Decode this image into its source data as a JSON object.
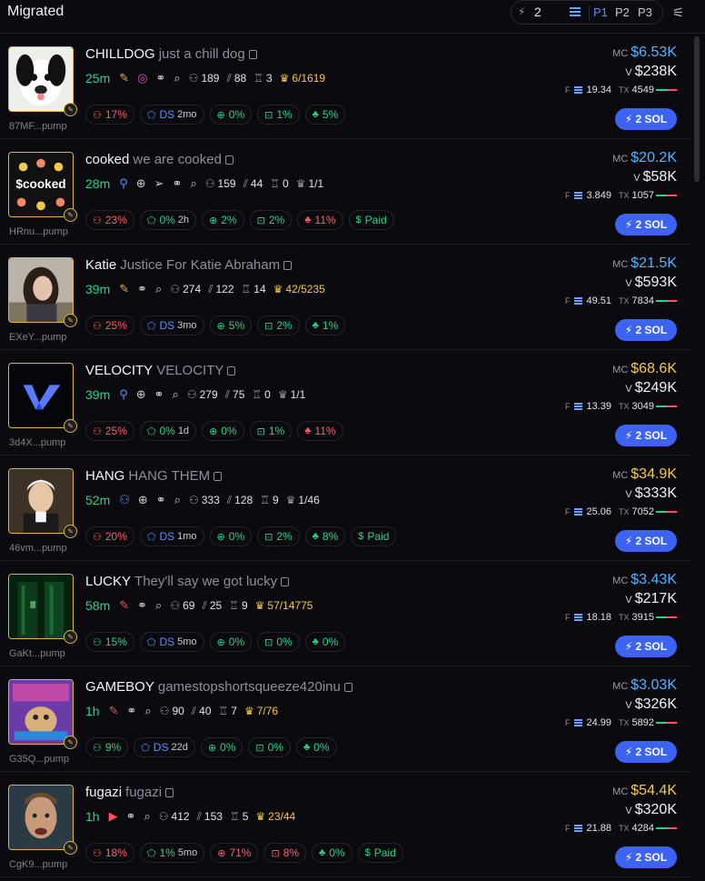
{
  "header": {
    "title": "Migrated",
    "speed": "2",
    "presets": [
      "P1",
      "P2",
      "P3"
    ]
  },
  "rows": [
    {
      "ticker": "CHILLDOG",
      "name": "just a chill dog",
      "age": "25m",
      "addr": "87MF...pump",
      "icons": [
        "feather-icon",
        "instagram-icon",
        "link-icon",
        "search-icon"
      ],
      "holders": "189",
      "pro": "88",
      "trophy": "3",
      "crown": "6/1619",
      "crown_gold": true,
      "pills": [
        {
          "name": "top10-pill",
          "glyph": "⚇",
          "text": "17%",
          "color": "red"
        },
        {
          "name": "dev-pill",
          "glyph": "⬠",
          "text": "DS",
          "sub": "2mo",
          "color": "blue"
        },
        {
          "name": "sniper-pill",
          "glyph": "⊕",
          "text": "0%",
          "color": "green"
        },
        {
          "name": "insider-pill",
          "glyph": "⊡",
          "text": "1%",
          "color": "green"
        },
        {
          "name": "bundle-pill",
          "glyph": "♣",
          "text": "5%",
          "color": "green"
        }
      ],
      "mc": "$6.53K",
      "mc_color": "blue",
      "vol": "$238K",
      "fees": "19.34",
      "tx": "4549",
      "buy_ratio": 0.6,
      "buy_label": "2 SOL"
    },
    {
      "ticker": "cooked",
      "name": "we are cooked",
      "age": "28m",
      "addr": "HRnu...pump",
      "icons": [
        "user-icon",
        "globe-icon",
        "telegram-icon",
        "link-icon",
        "search-icon"
      ],
      "holders": "159",
      "pro": "44",
      "trophy": "0",
      "crown": "1/1",
      "crown_gold": false,
      "pills": [
        {
          "name": "top10-pill",
          "glyph": "⚇",
          "text": "23%",
          "color": "red"
        },
        {
          "name": "dev-pill",
          "glyph": "⬠",
          "text": "0%",
          "sub": "2h",
          "color": "green"
        },
        {
          "name": "sniper-pill",
          "glyph": "⊕",
          "text": "2%",
          "color": "green"
        },
        {
          "name": "insider-pill",
          "glyph": "⊡",
          "text": "2%",
          "color": "green"
        },
        {
          "name": "bundle-pill",
          "glyph": "♣",
          "text": "11%",
          "color": "red"
        },
        {
          "name": "paid-pill",
          "glyph": "$",
          "text": "Paid",
          "color": "green"
        }
      ],
      "mc": "$20.2K",
      "mc_color": "blue",
      "vol": "$58K",
      "fees": "3.849",
      "tx": "1057",
      "buy_ratio": 0.5,
      "buy_label": "2 SOL"
    },
    {
      "ticker": "Katie",
      "name": "Justice For Katie Abraham",
      "age": "39m",
      "addr": "EXeY...pump",
      "icons": [
        "feather-icon",
        "link-icon",
        "search-icon"
      ],
      "holders": "274",
      "pro": "122",
      "trophy": "14",
      "crown": "42/5235",
      "crown_gold": true,
      "pills": [
        {
          "name": "top10-pill",
          "glyph": "⚇",
          "text": "25%",
          "color": "red"
        },
        {
          "name": "dev-pill",
          "glyph": "⬠",
          "text": "DS",
          "sub": "3mo",
          "color": "blue"
        },
        {
          "name": "sniper-pill",
          "glyph": "⊕",
          "text": "5%",
          "color": "green"
        },
        {
          "name": "insider-pill",
          "glyph": "⊡",
          "text": "2%",
          "color": "green"
        },
        {
          "name": "bundle-pill",
          "glyph": "♣",
          "text": "1%",
          "color": "green"
        }
      ],
      "mc": "$21.5K",
      "mc_color": "blue",
      "vol": "$593K",
      "fees": "49.51",
      "tx": "7834",
      "buy_ratio": 0.55,
      "buy_label": "2 SOL"
    },
    {
      "ticker": "VELOCITY",
      "name": "VELOCITY",
      "age": "39m",
      "addr": "3d4X...pump",
      "icons": [
        "user-icon",
        "globe-icon",
        "link-icon",
        "search-icon"
      ],
      "holders": "279",
      "pro": "75",
      "trophy": "0",
      "crown": "1/1",
      "crown_gold": false,
      "pills": [
        {
          "name": "top10-pill",
          "glyph": "⚇",
          "text": "25%",
          "color": "red"
        },
        {
          "name": "dev-pill",
          "glyph": "⬠",
          "text": "0%",
          "sub": "1d",
          "color": "green"
        },
        {
          "name": "sniper-pill",
          "glyph": "⊕",
          "text": "0%",
          "color": "green"
        },
        {
          "name": "insider-pill",
          "glyph": "⊡",
          "text": "1%",
          "color": "green"
        },
        {
          "name": "bundle-pill",
          "glyph": "♣",
          "text": "11%",
          "color": "red"
        }
      ],
      "mc": "$68.6K",
      "mc_color": "yellow",
      "vol": "$249K",
      "fees": "13.39",
      "tx": "3049",
      "buy_ratio": 0.5,
      "buy_label": "2 SOL"
    },
    {
      "ticker": "HANG",
      "name": "HANG THEM",
      "age": "52m",
      "addr": "46vm...pump",
      "icons": [
        "community-icon",
        "globe-icon",
        "link-icon",
        "search-icon"
      ],
      "holders": "333",
      "pro": "128",
      "trophy": "9",
      "crown": "1/46",
      "crown_gold": false,
      "pills": [
        {
          "name": "top10-pill",
          "glyph": "⚇",
          "text": "20%",
          "color": "red"
        },
        {
          "name": "dev-pill",
          "glyph": "⬠",
          "text": "DS",
          "sub": "1mo",
          "color": "blue"
        },
        {
          "name": "sniper-pill",
          "glyph": "⊕",
          "text": "0%",
          "color": "green"
        },
        {
          "name": "insider-pill",
          "glyph": "⊡",
          "text": "2%",
          "color": "green"
        },
        {
          "name": "bundle-pill",
          "glyph": "♣",
          "text": "8%",
          "color": "green"
        },
        {
          "name": "paid-pill",
          "glyph": "$",
          "text": "Paid",
          "color": "green"
        }
      ],
      "mc": "$34.9K",
      "mc_color": "yellow",
      "vol": "$333K",
      "fees": "25.06",
      "tx": "7052",
      "buy_ratio": 0.5,
      "buy_label": "2 SOL"
    },
    {
      "ticker": "LUCKY",
      "name": "They'll say we got lucky",
      "age": "58m",
      "addr": "GaKt...pump",
      "icons": [
        "feather-red-icon",
        "link-icon",
        "search-icon"
      ],
      "holders": "69",
      "pro": "25",
      "trophy": "9",
      "crown": "57/14775",
      "crown_gold": true,
      "pills": [
        {
          "name": "top10-pill",
          "glyph": "⚇",
          "text": "15%",
          "color": "green"
        },
        {
          "name": "dev-pill",
          "glyph": "⬠",
          "text": "DS",
          "sub": "5mo",
          "color": "blue"
        },
        {
          "name": "sniper-pill",
          "glyph": "⊕",
          "text": "0%",
          "color": "green"
        },
        {
          "name": "insider-pill",
          "glyph": "⊡",
          "text": "0%",
          "color": "green"
        },
        {
          "name": "bundle-pill",
          "glyph": "♣",
          "text": "0%",
          "color": "green"
        }
      ],
      "mc": "$3.43K",
      "mc_color": "blue",
      "vol": "$217K",
      "fees": "18.18",
      "tx": "3915",
      "buy_ratio": 0.5,
      "buy_label": "2 SOL"
    },
    {
      "ticker": "GAMEBOY",
      "name": "gamestopshortsqueeze420inu",
      "age": "1h",
      "addr": "G35Q...pump",
      "icons": [
        "feather-red-icon",
        "link-icon",
        "search-icon"
      ],
      "holders": "90",
      "pro": "40",
      "trophy": "7",
      "crown": "7/76",
      "crown_gold": true,
      "pills": [
        {
          "name": "top10-pill",
          "glyph": "⚇",
          "text": "9%",
          "color": "green"
        },
        {
          "name": "dev-pill",
          "glyph": "⬠",
          "text": "DS",
          "sub": "22d",
          "color": "blue"
        },
        {
          "name": "sniper-pill",
          "glyph": "⊕",
          "text": "0%",
          "color": "green"
        },
        {
          "name": "insider-pill",
          "glyph": "⊡",
          "text": "0%",
          "color": "green"
        },
        {
          "name": "bundle-pill",
          "glyph": "♣",
          "text": "0%",
          "color": "green"
        }
      ],
      "mc": "$3.03K",
      "mc_color": "blue",
      "vol": "$326K",
      "fees": "24.99",
      "tx": "5892",
      "buy_ratio": 0.5,
      "buy_label": "2 SOL"
    },
    {
      "ticker": "fugazi",
      "name": "fugazi",
      "age": "1h",
      "addr": "CgK9...pump",
      "icons": [
        "youtube-icon",
        "link-icon",
        "search-icon"
      ],
      "holders": "412",
      "pro": "153",
      "trophy": "5",
      "crown": "23/44",
      "crown_gold": true,
      "pills": [
        {
          "name": "top10-pill",
          "glyph": "⚇",
          "text": "18%",
          "color": "red"
        },
        {
          "name": "dev-pill",
          "glyph": "⬠",
          "text": "1%",
          "sub": "5mo",
          "color": "green"
        },
        {
          "name": "sniper-pill",
          "glyph": "⊕",
          "text": "71%",
          "color": "red"
        },
        {
          "name": "insider-pill",
          "glyph": "⊡",
          "text": "8%",
          "color": "red"
        },
        {
          "name": "bundle-pill",
          "glyph": "♣",
          "text": "0%",
          "color": "green"
        },
        {
          "name": "paid-pill",
          "glyph": "$",
          "text": "Paid",
          "color": "green"
        }
      ],
      "mc": "$54.4K",
      "mc_color": "yellow",
      "vol": "$320K",
      "fees": "21.88",
      "tx": "4284",
      "buy_ratio": 0.55,
      "buy_label": "2 SOL"
    }
  ],
  "labels": {
    "mc": "MC",
    "vol": "V",
    "fees": "F",
    "tx": "TX"
  }
}
